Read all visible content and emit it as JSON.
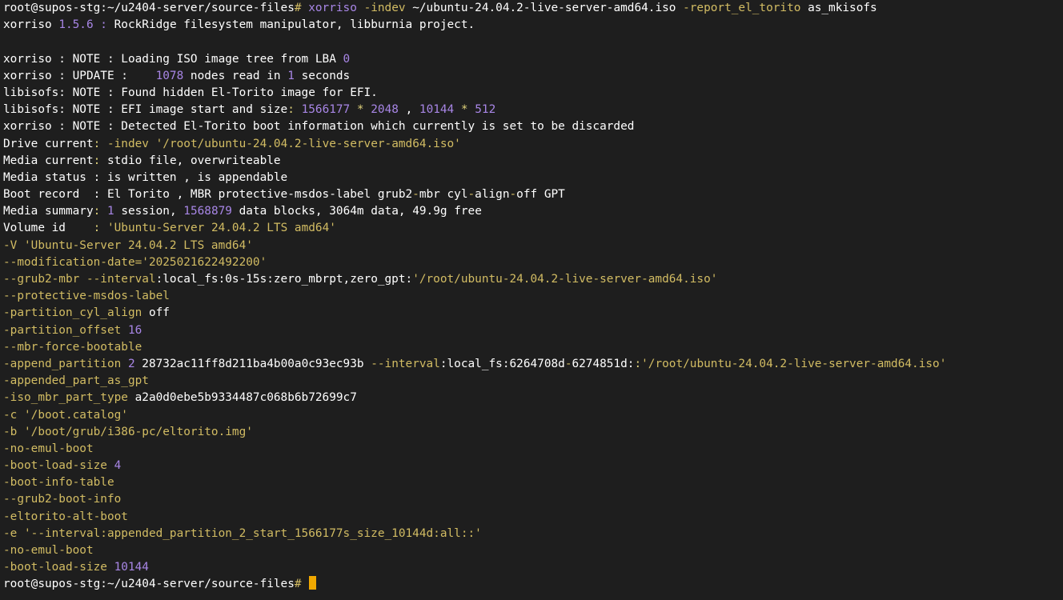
{
  "palette": {
    "background": "#1e1e1e",
    "text": "#ffffff",
    "option": "#d2bc63",
    "number": "#a886e6",
    "separator": "#e0d27a",
    "cursor": "#f0a800"
  },
  "terminal": {
    "lines": [
      [
        {
          "t": "root@supos-stg:~/u2404-server/source-files",
          "c": "text"
        },
        {
          "t": "#",
          "c": "option"
        },
        {
          "t": " ",
          "c": "text"
        },
        {
          "t": "xorriso",
          "c": "number"
        },
        {
          "t": " ",
          "c": "text"
        },
        {
          "t": "-indev",
          "c": "option"
        },
        {
          "t": " ~/ubuntu-24.04.2-live-server-amd64.iso ",
          "c": "text"
        },
        {
          "t": "-report_el_torito",
          "c": "option"
        },
        {
          "t": " as_mkisofs",
          "c": "text"
        }
      ],
      [
        {
          "t": "xorriso ",
          "c": "text"
        },
        {
          "t": "1.5.6 :",
          "c": "number"
        },
        {
          "t": " RockRidge filesystem manipulator, libburnia project.",
          "c": "text"
        }
      ],
      [],
      [
        {
          "t": "xorriso : NOTE : Loading ISO image tree from LBA ",
          "c": "text"
        },
        {
          "t": "0",
          "c": "number"
        }
      ],
      [
        {
          "t": "xorriso : UPDATE :    ",
          "c": "text"
        },
        {
          "t": "1078",
          "c": "number"
        },
        {
          "t": " nodes read in ",
          "c": "text"
        },
        {
          "t": "1",
          "c": "number"
        },
        {
          "t": " seconds",
          "c": "text"
        }
      ],
      [
        {
          "t": "libisofs: NOTE : Found hidden El-Torito image for EFI.",
          "c": "text"
        }
      ],
      [
        {
          "t": "libisofs: NOTE : EFI image start and size",
          "c": "text"
        },
        {
          "t": ":",
          "c": "separator"
        },
        {
          "t": " ",
          "c": "text"
        },
        {
          "t": "1566177",
          "c": "number"
        },
        {
          "t": " ",
          "c": "text"
        },
        {
          "t": "*",
          "c": "separator"
        },
        {
          "t": " ",
          "c": "text"
        },
        {
          "t": "2048",
          "c": "number"
        },
        {
          "t": " , ",
          "c": "text"
        },
        {
          "t": "10144",
          "c": "number"
        },
        {
          "t": " ",
          "c": "text"
        },
        {
          "t": "*",
          "c": "separator"
        },
        {
          "t": " ",
          "c": "text"
        },
        {
          "t": "512",
          "c": "number"
        }
      ],
      [
        {
          "t": "xorriso : NOTE : Detected El-Torito boot information which currently is set to be discarded",
          "c": "text"
        }
      ],
      [
        {
          "t": "Drive current",
          "c": "text"
        },
        {
          "t": ":",
          "c": "separator"
        },
        {
          "t": " ",
          "c": "text"
        },
        {
          "t": "-indev '/root/ubuntu-24.04.2-live-server-amd64.iso'",
          "c": "option"
        }
      ],
      [
        {
          "t": "Media current",
          "c": "text"
        },
        {
          "t": ":",
          "c": "separator"
        },
        {
          "t": " stdio file, overwriteable",
          "c": "text"
        }
      ],
      [
        {
          "t": "Media status : is written , is appendable",
          "c": "text"
        }
      ],
      [
        {
          "t": "Boot record  : El Torito , MBR protective-msdos-label grub2",
          "c": "text"
        },
        {
          "t": "-",
          "c": "option"
        },
        {
          "t": "mbr cyl",
          "c": "text"
        },
        {
          "t": "-",
          "c": "option"
        },
        {
          "t": "align",
          "c": "text"
        },
        {
          "t": "-",
          "c": "option"
        },
        {
          "t": "off GPT",
          "c": "text"
        }
      ],
      [
        {
          "t": "Media summary",
          "c": "text"
        },
        {
          "t": ":",
          "c": "separator"
        },
        {
          "t": " ",
          "c": "text"
        },
        {
          "t": "1",
          "c": "number"
        },
        {
          "t": " session, ",
          "c": "text"
        },
        {
          "t": "1568879",
          "c": "number"
        },
        {
          "t": " data blocks, 3064m data, 49.9g free",
          "c": "text"
        }
      ],
      [
        {
          "t": "Volume id    ",
          "c": "text"
        },
        {
          "t": ":",
          "c": "separator"
        },
        {
          "t": " ",
          "c": "text"
        },
        {
          "t": "'Ubuntu-Server 24.04.2 LTS amd64'",
          "c": "option"
        }
      ],
      [
        {
          "t": "-V 'Ubuntu-Server 24.04.2 LTS amd64'",
          "c": "option"
        }
      ],
      [
        {
          "t": "--modification-date='2025021622492200'",
          "c": "option"
        }
      ],
      [
        {
          "t": "--grub2-mbr --interval",
          "c": "option"
        },
        {
          "t": ":local_fs:0s-15s:zero_mbrpt,zero_gpt:",
          "c": "text"
        },
        {
          "t": "'/root/ubuntu-24.04.2-live-server-amd64.iso'",
          "c": "option"
        }
      ],
      [
        {
          "t": "--protective-msdos-label",
          "c": "option"
        }
      ],
      [
        {
          "t": "-partition_cyl_align",
          "c": "option"
        },
        {
          "t": " off",
          "c": "text"
        }
      ],
      [
        {
          "t": "-partition_offset",
          "c": "option"
        },
        {
          "t": " ",
          "c": "text"
        },
        {
          "t": "16",
          "c": "number"
        }
      ],
      [
        {
          "t": "--mbr-force-bootable",
          "c": "option"
        }
      ],
      [
        {
          "t": "-append_partition",
          "c": "option"
        },
        {
          "t": " ",
          "c": "text"
        },
        {
          "t": "2",
          "c": "number"
        },
        {
          "t": " 28732ac11ff8d211ba4b00a0c93ec93b ",
          "c": "text"
        },
        {
          "t": "--interval",
          "c": "option"
        },
        {
          "t": ":local_fs:6264708d",
          "c": "text"
        },
        {
          "t": "-",
          "c": "option"
        },
        {
          "t": "6274851d:",
          "c": "text"
        },
        {
          "t": ":",
          "c": "separator"
        },
        {
          "t": "'/root/ubuntu-24.04.2-live-server-amd64.iso'",
          "c": "option"
        }
      ],
      [
        {
          "t": "-appended_part_as_gpt",
          "c": "option"
        }
      ],
      [
        {
          "t": "-iso_mbr_part_type",
          "c": "option"
        },
        {
          "t": " a2a0d0ebe5b9334487c068b6b72699c7",
          "c": "text"
        }
      ],
      [
        {
          "t": "-c '/boot.catalog'",
          "c": "option"
        }
      ],
      [
        {
          "t": "-b '/boot/grub/i386-pc/eltorito.img'",
          "c": "option"
        }
      ],
      [
        {
          "t": "-no-emul-boot",
          "c": "option"
        }
      ],
      [
        {
          "t": "-boot-load-size",
          "c": "option"
        },
        {
          "t": " ",
          "c": "text"
        },
        {
          "t": "4",
          "c": "number"
        }
      ],
      [
        {
          "t": "-boot-info-table",
          "c": "option"
        }
      ],
      [
        {
          "t": "--grub2-boot-info",
          "c": "option"
        }
      ],
      [
        {
          "t": "-eltorito-alt-boot",
          "c": "option"
        }
      ],
      [
        {
          "t": "-e '--interval:appended_partition_2_start_1566177s_size_10144d:all::'",
          "c": "option"
        }
      ],
      [
        {
          "t": "-no-emul-boot",
          "c": "option"
        }
      ],
      [
        {
          "t": "-boot-load-size",
          "c": "option"
        },
        {
          "t": " ",
          "c": "text"
        },
        {
          "t": "10144",
          "c": "number"
        }
      ],
      [
        {
          "t": "root@supos-stg:~/u2404-server/source-files",
          "c": "text"
        },
        {
          "t": "#",
          "c": "option"
        },
        {
          "t": " ",
          "c": "text"
        }
      ]
    ]
  }
}
